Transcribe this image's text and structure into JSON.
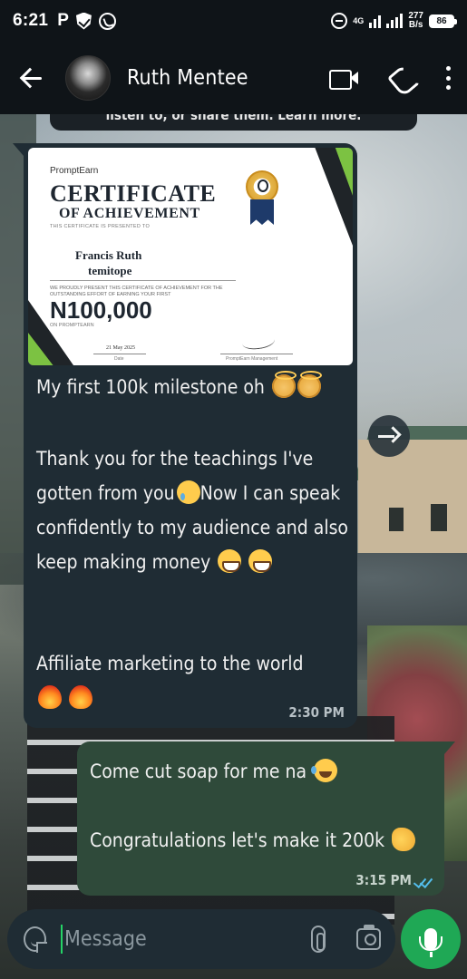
{
  "status_bar": {
    "time": "6:21",
    "carrier_letter": "P",
    "network_label": "4G",
    "speed_value": "277",
    "speed_unit": "B/s",
    "battery": "86"
  },
  "header": {
    "contact_name": "Ruth Mentee"
  },
  "pinned_notice": {
    "text": "listen to, or share them. Learn more."
  },
  "messages": [
    {
      "direction": "incoming",
      "certificate": {
        "brand": "PromptEarn",
        "title": "CERTIFICATE",
        "subtitle": "OF ACHIEVEMENT",
        "presented_to": "THIS CERTIFICATE IS PRESENTED TO",
        "recipient_line1": "Francis Ruth",
        "recipient_line2": "temitope",
        "description": "WE PROUDLY PRESENT THIS CERTIFICATE OF ACHIEVEMENT FOR THE OUTSTANDING EFFORT OF EARNING YOUR FIRST",
        "amount": "N100,000",
        "platform": "ON PROMPTEARN",
        "date": "21 May 2025",
        "date_label": "Date",
        "signatory": "PromptEarn Management"
      },
      "line1": "My first 100k milestone oh",
      "line2": "Thank you for the teachings I've gotten from you",
      "line3": "Now I can speak confidently to my audience and also keep making money",
      "line4": "Affiliate marketing to the world",
      "time": "2:30 PM"
    },
    {
      "direction": "outgoing",
      "line1": "Come cut soap for me na",
      "line2": "Congratulations let's make it 200k",
      "time": "3:15 PM",
      "status": "read"
    }
  ],
  "composer": {
    "placeholder": "Message"
  },
  "icons": {
    "back": "back-arrow-icon",
    "video": "video-call-icon",
    "call": "phone-icon",
    "menu": "more-vert-icon",
    "forward": "forward-icon",
    "sticker": "sticker-icon",
    "attach": "paperclip-icon",
    "camera": "camera-icon",
    "mic": "mic-icon"
  },
  "colors": {
    "header_bg": "#0f1418",
    "incoming_bubble": "#1f2c34",
    "outgoing_bubble": "#2f4a3a",
    "accent_green": "#1fa855",
    "read_ticks": "#53bdeb"
  }
}
